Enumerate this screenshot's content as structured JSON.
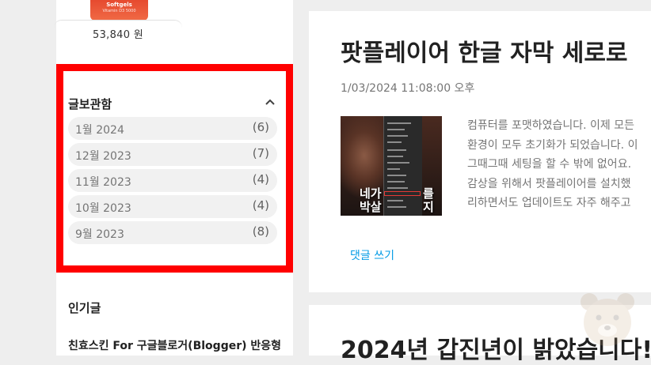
{
  "product": {
    "image_brand": "Softgels",
    "image_sub": "Vitamin D3 5000",
    "price": "53,840 원"
  },
  "archive": {
    "title": "글보관함",
    "items": [
      {
        "label": "1월 2024",
        "count": "(6)"
      },
      {
        "label": "12월 2023",
        "count": "(7)"
      },
      {
        "label": "11월 2023",
        "count": "(4)"
      },
      {
        "label": "10월 2023",
        "count": "(4)"
      },
      {
        "label": "9월 2023",
        "count": "(8)"
      }
    ]
  },
  "popular": {
    "title": "인기글",
    "first_link": "친효스킨 For 구글블로거(Blogger) 반응형"
  },
  "posts": [
    {
      "title": "팟플레이어 한글 자막 세로로",
      "date": "1/03/2024 11:08:00 오후",
      "thumbnail_caption_left": [
        "네가",
        "박살"
      ],
      "thumbnail_caption_right": [
        "를",
        "지"
      ],
      "snippet_lines": [
        "컴퓨터를 포맷하였습니다. 이제 모든",
        "환경이 모두 초기화가 되었습니다. 이",
        "그때그때 세팅을 할 수 밖에 없어요.",
        "감상을 위해서 팟플레이어를 설치했",
        "리하면서도 업데이트도 자주 해주고"
      ],
      "comment_link": "댓글 쓰기"
    },
    {
      "title": "2024년 갑진년이 밝았습니다!"
    }
  ],
  "colors": {
    "highlight": "#ff0000",
    "link": "#039be5",
    "background": "#eeeeee"
  },
  "icons": {
    "collapse": "chevron-up-icon",
    "watermark": "bear-icon"
  }
}
